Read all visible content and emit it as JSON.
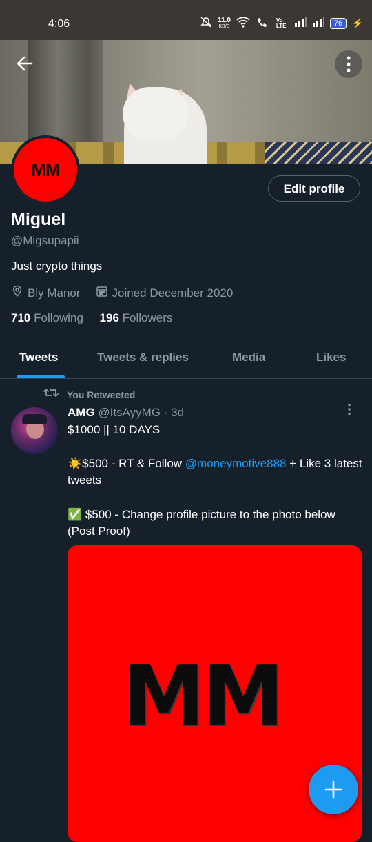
{
  "status_bar": {
    "time": "4:06",
    "net_speed": "11.0",
    "net_unit": "KB/S",
    "volte": "Vo LTE",
    "battery": "76",
    "icons": [
      "mute-icon",
      "wifi-icon",
      "wifi-call-icon",
      "signal-icon",
      "signal-icon",
      "battery-icon",
      "charging-icon"
    ]
  },
  "header": {
    "back_icon": "arrow-left-icon",
    "more_icon": "more-vertical-icon"
  },
  "profile": {
    "avatar_text": "MM",
    "edit_label": "Edit profile",
    "name": "Miguel",
    "handle": "@Migsupapii",
    "bio": "Just crypto things",
    "location": "Bly Manor",
    "joined": "Joined December 2020",
    "following_count": "710",
    "following_label": "Following",
    "followers_count": "196",
    "followers_label": "Followers"
  },
  "tabs": [
    {
      "label": "Tweets",
      "active": true
    },
    {
      "label": "Tweets & replies",
      "active": false
    },
    {
      "label": "Media",
      "active": false
    },
    {
      "label": "Likes",
      "active": false
    }
  ],
  "tweet": {
    "retweet_label": "You Retweeted",
    "author_name": "AMG",
    "author_handle": "@ItsAyyMG",
    "time": "· 3d",
    "line1": "$1000 || 10 DAYS",
    "line2_prefix": "☀️$500 - RT & Follow ",
    "line2_link": "@moneymotive888",
    "line2_suffix": " + Like 3 latest tweets",
    "line3": "✅ $500 - Change profile picture to the photo below (Post Proof)",
    "image_text": "MM"
  },
  "fab": {
    "icon": "plus-icon"
  },
  "colors": {
    "background": "#15202b",
    "accent": "#1d9bf0",
    "muted": "#8b98a5",
    "avatar_red": "#ff0000"
  }
}
